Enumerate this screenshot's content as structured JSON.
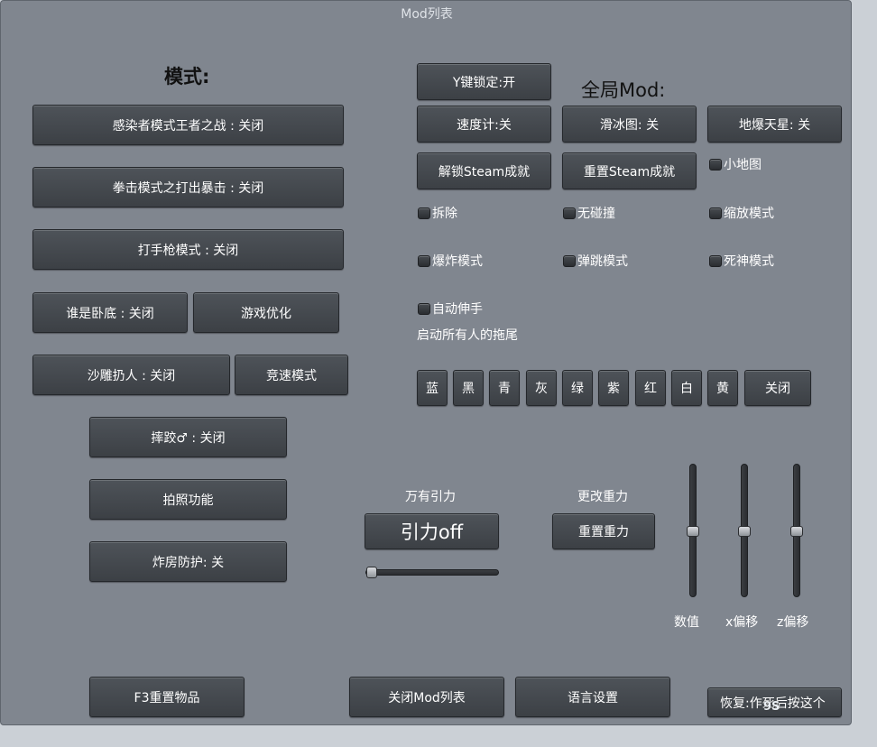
{
  "window": {
    "title": "Mod列表"
  },
  "modes": {
    "heading": "模式:",
    "infected_king": "感染者模式王者之战 : 关闭",
    "boxing": "拳击模式之打出暴击 : 关闭",
    "pistol": "打手枪模式 : 关闭",
    "undercover": "谁是卧底 : 关闭",
    "optimize": "游戏优化",
    "toss": "沙雕扔人 : 关闭",
    "racing": "竞速模式",
    "wrestle": "摔跤♂ : 关闭",
    "photo": "拍照功能",
    "blast_guard": "炸房防护: 关"
  },
  "global": {
    "heading": "全局Mod:",
    "y_lock": "Y键锁定:开",
    "speedometer": "速度计:关",
    "skate_map": "滑冰图: 关",
    "meteor": "地爆天星: 关",
    "unlock_steam": "解锁Steam成就",
    "reset_steam": "重置Steam成就",
    "toggles": {
      "minimap": "小地图",
      "dismantle": "拆除",
      "no_collision": "无碰撞",
      "zoom_mode": "缩放模式",
      "explosion_mode": "爆炸模式",
      "bounce_mode": "弹跳模式",
      "reaper_mode": "死神模式",
      "auto_reach": "自动伸手"
    },
    "trail_label": "启动所有人的拖尾",
    "colors": [
      "蓝",
      "黑",
      "青",
      "灰",
      "绿",
      "紫",
      "红",
      "白",
      "黄"
    ],
    "trail_close": "关闭"
  },
  "gravity": {
    "universal_label": "万有引力",
    "gravity_toggle": "引力off",
    "universal_slider_value": 0.0,
    "change_label": "更改重力",
    "reset_gravity": "重置重力",
    "value_label": "数值",
    "x_offset_label": "x偏移",
    "z_offset_label": "z偏移",
    "value_level": 0.5,
    "x_offset_level": 0.5,
    "z_offset_level": 0.5
  },
  "footer": {
    "f3_reset": "F3重置物品",
    "close_mod_list": "关闭Mod列表",
    "language": "语言设置",
    "restore": "恢复:作死后按这个"
  }
}
